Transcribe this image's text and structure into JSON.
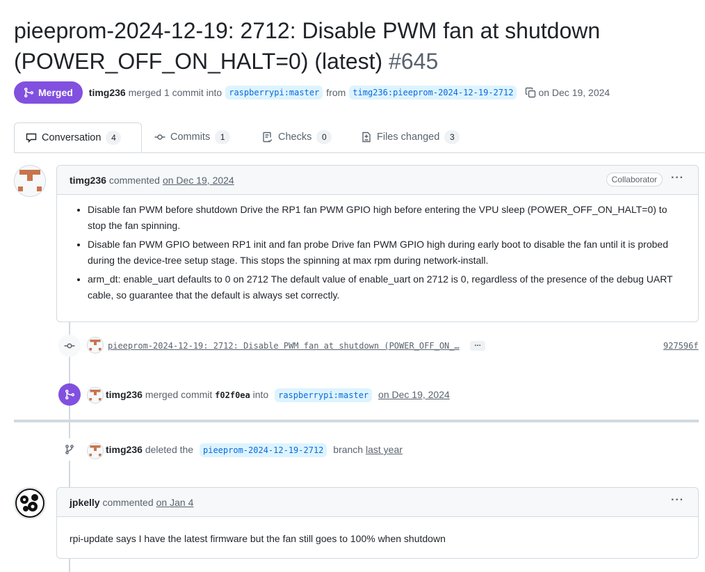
{
  "pr": {
    "title": "pieeprom-2024-12-19: 2712: Disable PWM fan at shutdown (POWER_OFF_ON_HALT=0) (latest)",
    "number": "#645",
    "state": "Merged",
    "author": "timg236",
    "merge_text": "merged 1 commit into",
    "base_branch": "raspberrypi:master",
    "from_text": "from",
    "head_branch": "timg236:pieeprom-2024-12-19-2712",
    "date": "on Dec 19, 2024"
  },
  "tabs": [
    {
      "label": "Conversation",
      "count": "4",
      "icon": "comment-icon",
      "selected": true
    },
    {
      "label": "Commits",
      "count": "1",
      "icon": "commit-icon"
    },
    {
      "label": "Checks",
      "count": "0",
      "icon": "checklist-icon"
    },
    {
      "label": "Files changed",
      "count": "3",
      "icon": "file-diff-icon"
    }
  ],
  "comment1": {
    "author": "timg236",
    "action": "commented",
    "date": "on Dec 19, 2024",
    "role": "Collaborator",
    "bullets": [
      "Disable fan PWM before shutdown Drive the RP1 fan PWM GPIO high before entering the VPU sleep (POWER_OFF_ON_HALT=0) to stop the fan spinning.",
      "Disable fan PWM GPIO between RP1 init and fan probe Drive fan PWM GPIO high during early boot to disable the fan until it is probed during the device-tree setup stage. This stops the spinning at max rpm during network-install.",
      "arm_dt: enable_uart defaults to 0 on 2712 The default value of enable_uart on 2712 is 0, regardless of the presence of the debug UART cable, so guarantee that the default is always set correctly."
    ]
  },
  "commit": {
    "message": "pieeprom-2024-12-19: 2712: Disable PWM fan at shutdown (POWER_OFF_ON_…",
    "ellipsis": "…",
    "sha": "927596f"
  },
  "merge_event": {
    "author": "timg236",
    "text": "merged commit",
    "sha": "f02f0ea",
    "into": "into",
    "branch": "raspberrypi:master",
    "date": "on Dec 19, 2024"
  },
  "delete_event": {
    "author": "timg236",
    "text": "deleted the",
    "branch": "pieeprom-2024-12-19-2712",
    "suffix": "branch",
    "date": "last year"
  },
  "comment2": {
    "author": "jpkelly",
    "action": "commented",
    "date": "on Jan 4",
    "body": "rpi-update says I have the latest firmware but the fan still goes to 100% when shutdown"
  },
  "colors": {
    "merged": "#8250df",
    "link": "#0969da",
    "branch_bg": "#ddf4ff",
    "border": "#d1d9e0"
  }
}
